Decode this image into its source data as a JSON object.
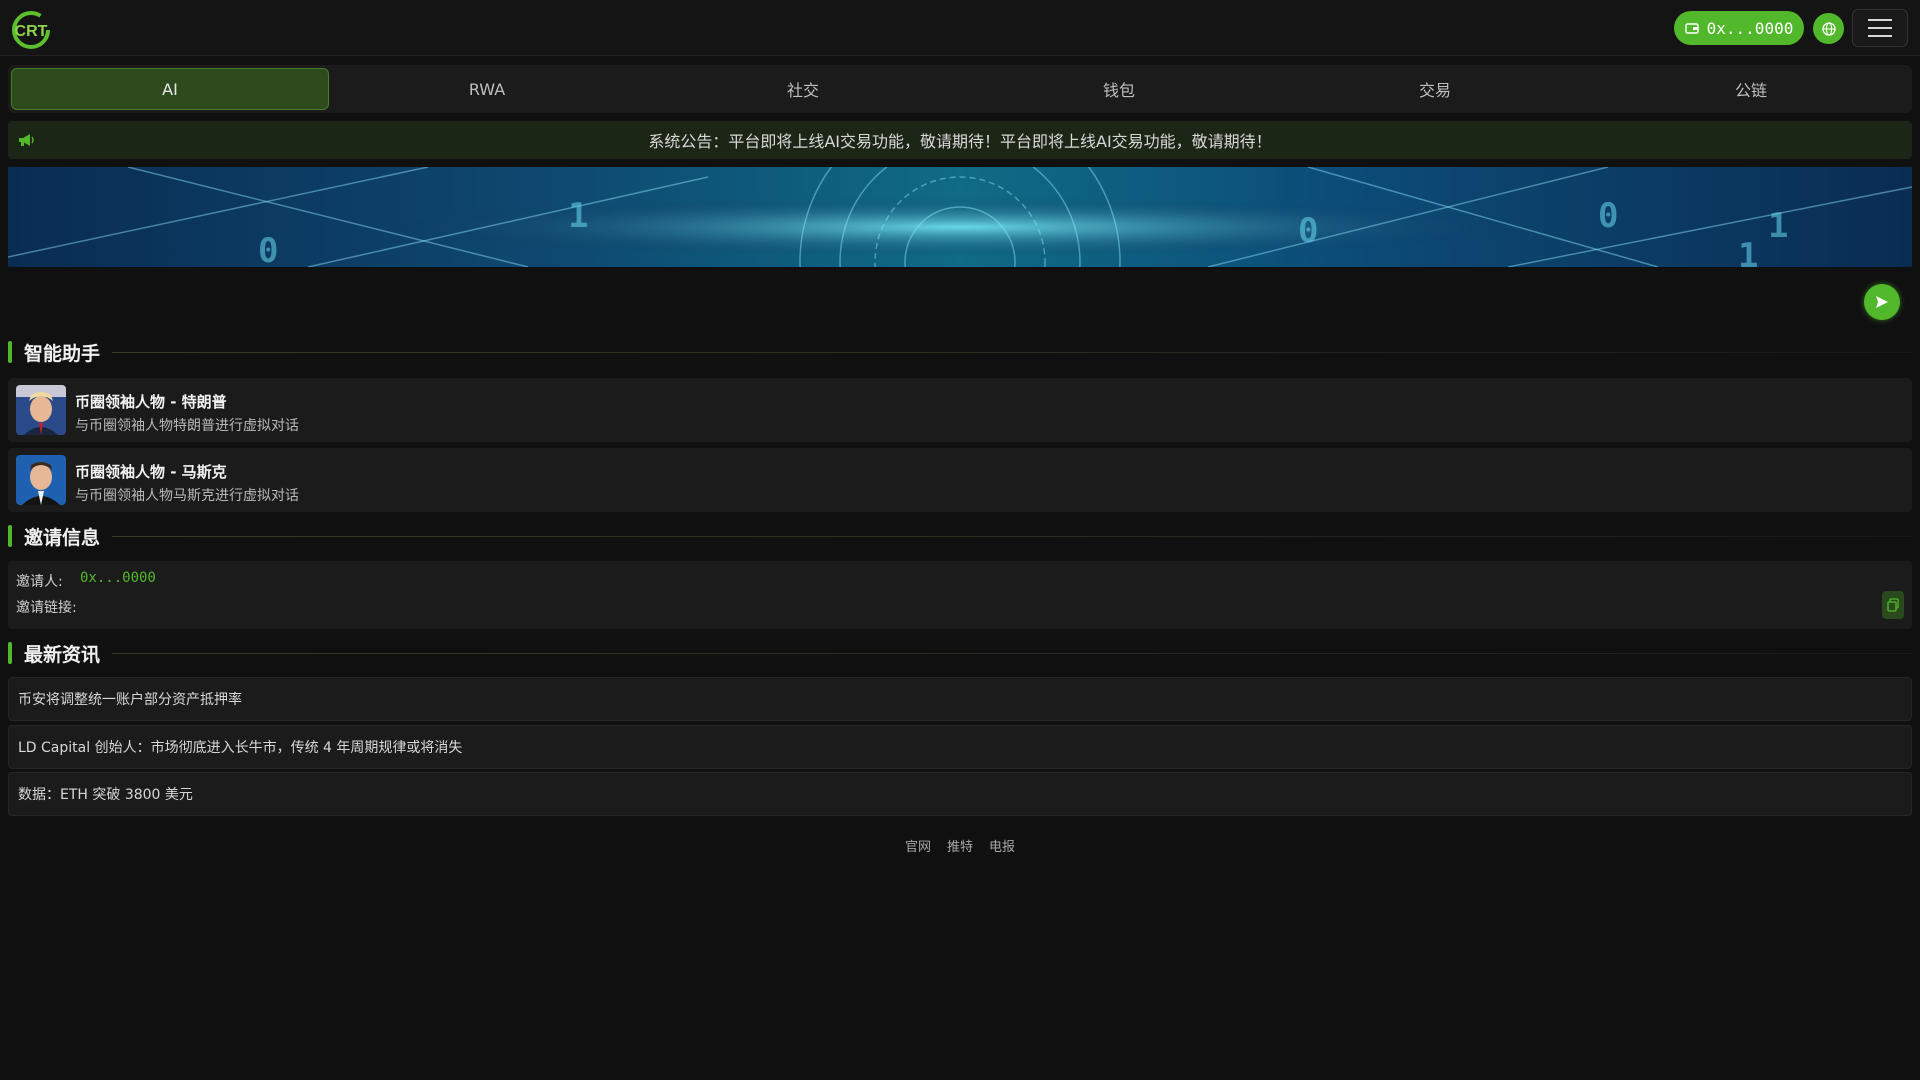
{
  "header": {
    "logo_text": "CRT",
    "wallet_address": "0x...0000",
    "icons": {
      "wallet": "wallet-icon",
      "globe": "globe-icon",
      "menu": "hamburger-menu-icon"
    },
    "accent_color": "#52b82b"
  },
  "tabs": [
    {
      "label": "AI",
      "active": true
    },
    {
      "label": "RWA",
      "active": false
    },
    {
      "label": "社交",
      "active": false
    },
    {
      "label": "钱包",
      "active": false
    },
    {
      "label": "交易",
      "active": false
    },
    {
      "label": "公链",
      "active": false
    }
  ],
  "notice": {
    "icon": "megaphone-icon",
    "text": "系统公告：平台即将上线AI交易功能，敬请期待！平台即将上线AI交易功能，敬请期待！"
  },
  "banner": {
    "slides": 3,
    "active_slide": 1
  },
  "ai_input": {
    "value": "",
    "placeholder": ""
  },
  "sections": {
    "assistant_title": "智能助手",
    "invite_title": "邀请信息",
    "news_title": "最新资讯"
  },
  "assistants": [
    {
      "name": "币圈领袖人物 - 特朗普",
      "desc": "与币圈领袖人物特朗普进行虚拟对话"
    },
    {
      "name": "币圈领袖人物 - 马斯克",
      "desc": "与币圈领袖人物马斯克进行虚拟对话"
    }
  ],
  "invite": {
    "inviter_label": "邀请人:",
    "inviter_value": "0x...0000",
    "link_label": "邀请链接:"
  },
  "news": [
    "币安将调整统一账户部分资产抵押率",
    "LD Capital 创始人：市场彻底进入长牛市，传统 4 年周期规律或将消失",
    "数据：ETH 突破 3800 美元"
  ],
  "footer": {
    "links": [
      "官网",
      "推特",
      "电报"
    ]
  }
}
